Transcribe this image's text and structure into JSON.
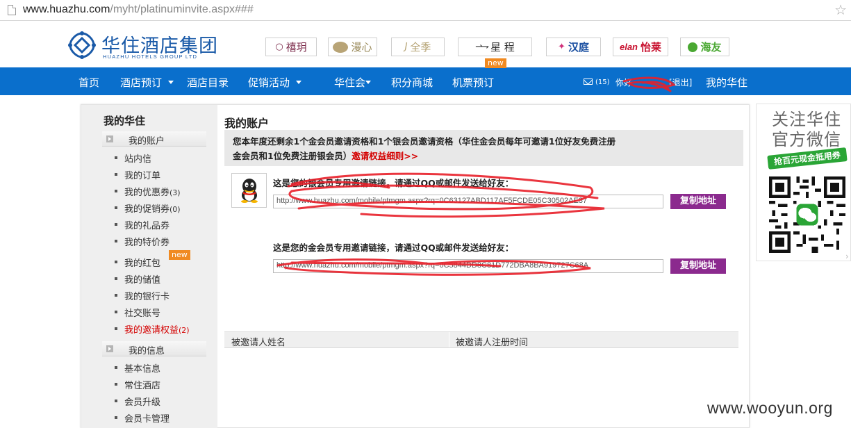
{
  "browser": {
    "url_host": "www.huazhu.com",
    "url_path": "/myht/platinuminvite.aspx###"
  },
  "logo": {
    "cn": "华住酒店集团",
    "en": "HUAZHU HOTELS GROUP LTD"
  },
  "brands": [
    {
      "label": "禧玥",
      "icon": "circle-icon",
      "color": "#7b2a4a"
    },
    {
      "label": "漫心",
      "icon": "leaf-icon",
      "color": "#9a8a5a"
    },
    {
      "label": "全季",
      "icon": "ji-icon",
      "color": "#b3a070"
    },
    {
      "label": "星 程",
      "icon": "arrows-icon",
      "color": "#333333"
    },
    {
      "label": "汉庭",
      "icon": "hanting-icon",
      "color": "#1a4fa0"
    },
    {
      "label": "怡莱",
      "prefix": "elan",
      "icon": "elan-icon",
      "color": "#c8102e"
    },
    {
      "label": "海友",
      "icon": "haiyou-icon",
      "color": "#4aa832"
    }
  ],
  "nav": {
    "home": "首页",
    "booking": "酒店预订",
    "directory": "酒店目录",
    "promo": "促销活动",
    "club": "华住会",
    "points_mall": "积分商城",
    "flight": "机票预订",
    "flight_badge": "new",
    "mail_count": "(15)",
    "greeting": "你好",
    "logout": "[退出]",
    "my_huazhu": "我的华住"
  },
  "sidebar": {
    "title": "我的华住",
    "group1": "我的账户",
    "items1": [
      {
        "label": "站内信",
        "count": ""
      },
      {
        "label": "我的订单",
        "count": ""
      },
      {
        "label": "我的优惠券",
        "count": "(3)"
      },
      {
        "label": "我的促销券",
        "count": "(0)"
      },
      {
        "label": "我的礼品券",
        "count": ""
      },
      {
        "label": "我的特价券",
        "count": ""
      },
      {
        "label": "我的红包",
        "count": ""
      },
      {
        "label": "我的储值",
        "count": ""
      },
      {
        "label": "我的银行卡",
        "count": ""
      },
      {
        "label": "社交账号",
        "count": ""
      },
      {
        "label": "我的邀请权益",
        "count": "(2)"
      }
    ],
    "red_packet_badge": "new",
    "group2": "我的信息",
    "items2": [
      {
        "label": "基本信息"
      },
      {
        "label": "常住酒店"
      },
      {
        "label": "会员升级"
      },
      {
        "label": "会员卡管理"
      }
    ]
  },
  "main": {
    "title": "我的账户",
    "notice_line1": "您本年度还剩余1个金会员邀请资格和1个银会员邀请资格（华住金会员每年可邀请1位好友免费注册",
    "notice_line2": "金会员和1位免费注册银会员）",
    "notice_link": "邀请权益细则>>",
    "silver_label": "这是您的银会员专用邀请链接，请通过QQ或邮件发送给好友：",
    "silver_url": "http://www.huazhu.com/mobile/ptmgm.aspx?rq=0C63127ABD117AF5FCDE05C30502AE37",
    "gold_label": "这是您的金会员专用邀请链接，请通过QQ或邮件发送给好友：",
    "gold_url": "http://www.huazhu.com/mobile/ptmgm.aspx?rq=0C5844DD8C81D772DBA8BA919727C68A",
    "copy_button": "复制地址",
    "table_col1": "被邀请人姓名",
    "table_col2": "被邀请人注册时间"
  },
  "qr": {
    "title_line1": "关注华住",
    "title_line2": "官方微信",
    "tag": "抢百元现金抵用券"
  },
  "watermark": "www.wooyun.org"
}
